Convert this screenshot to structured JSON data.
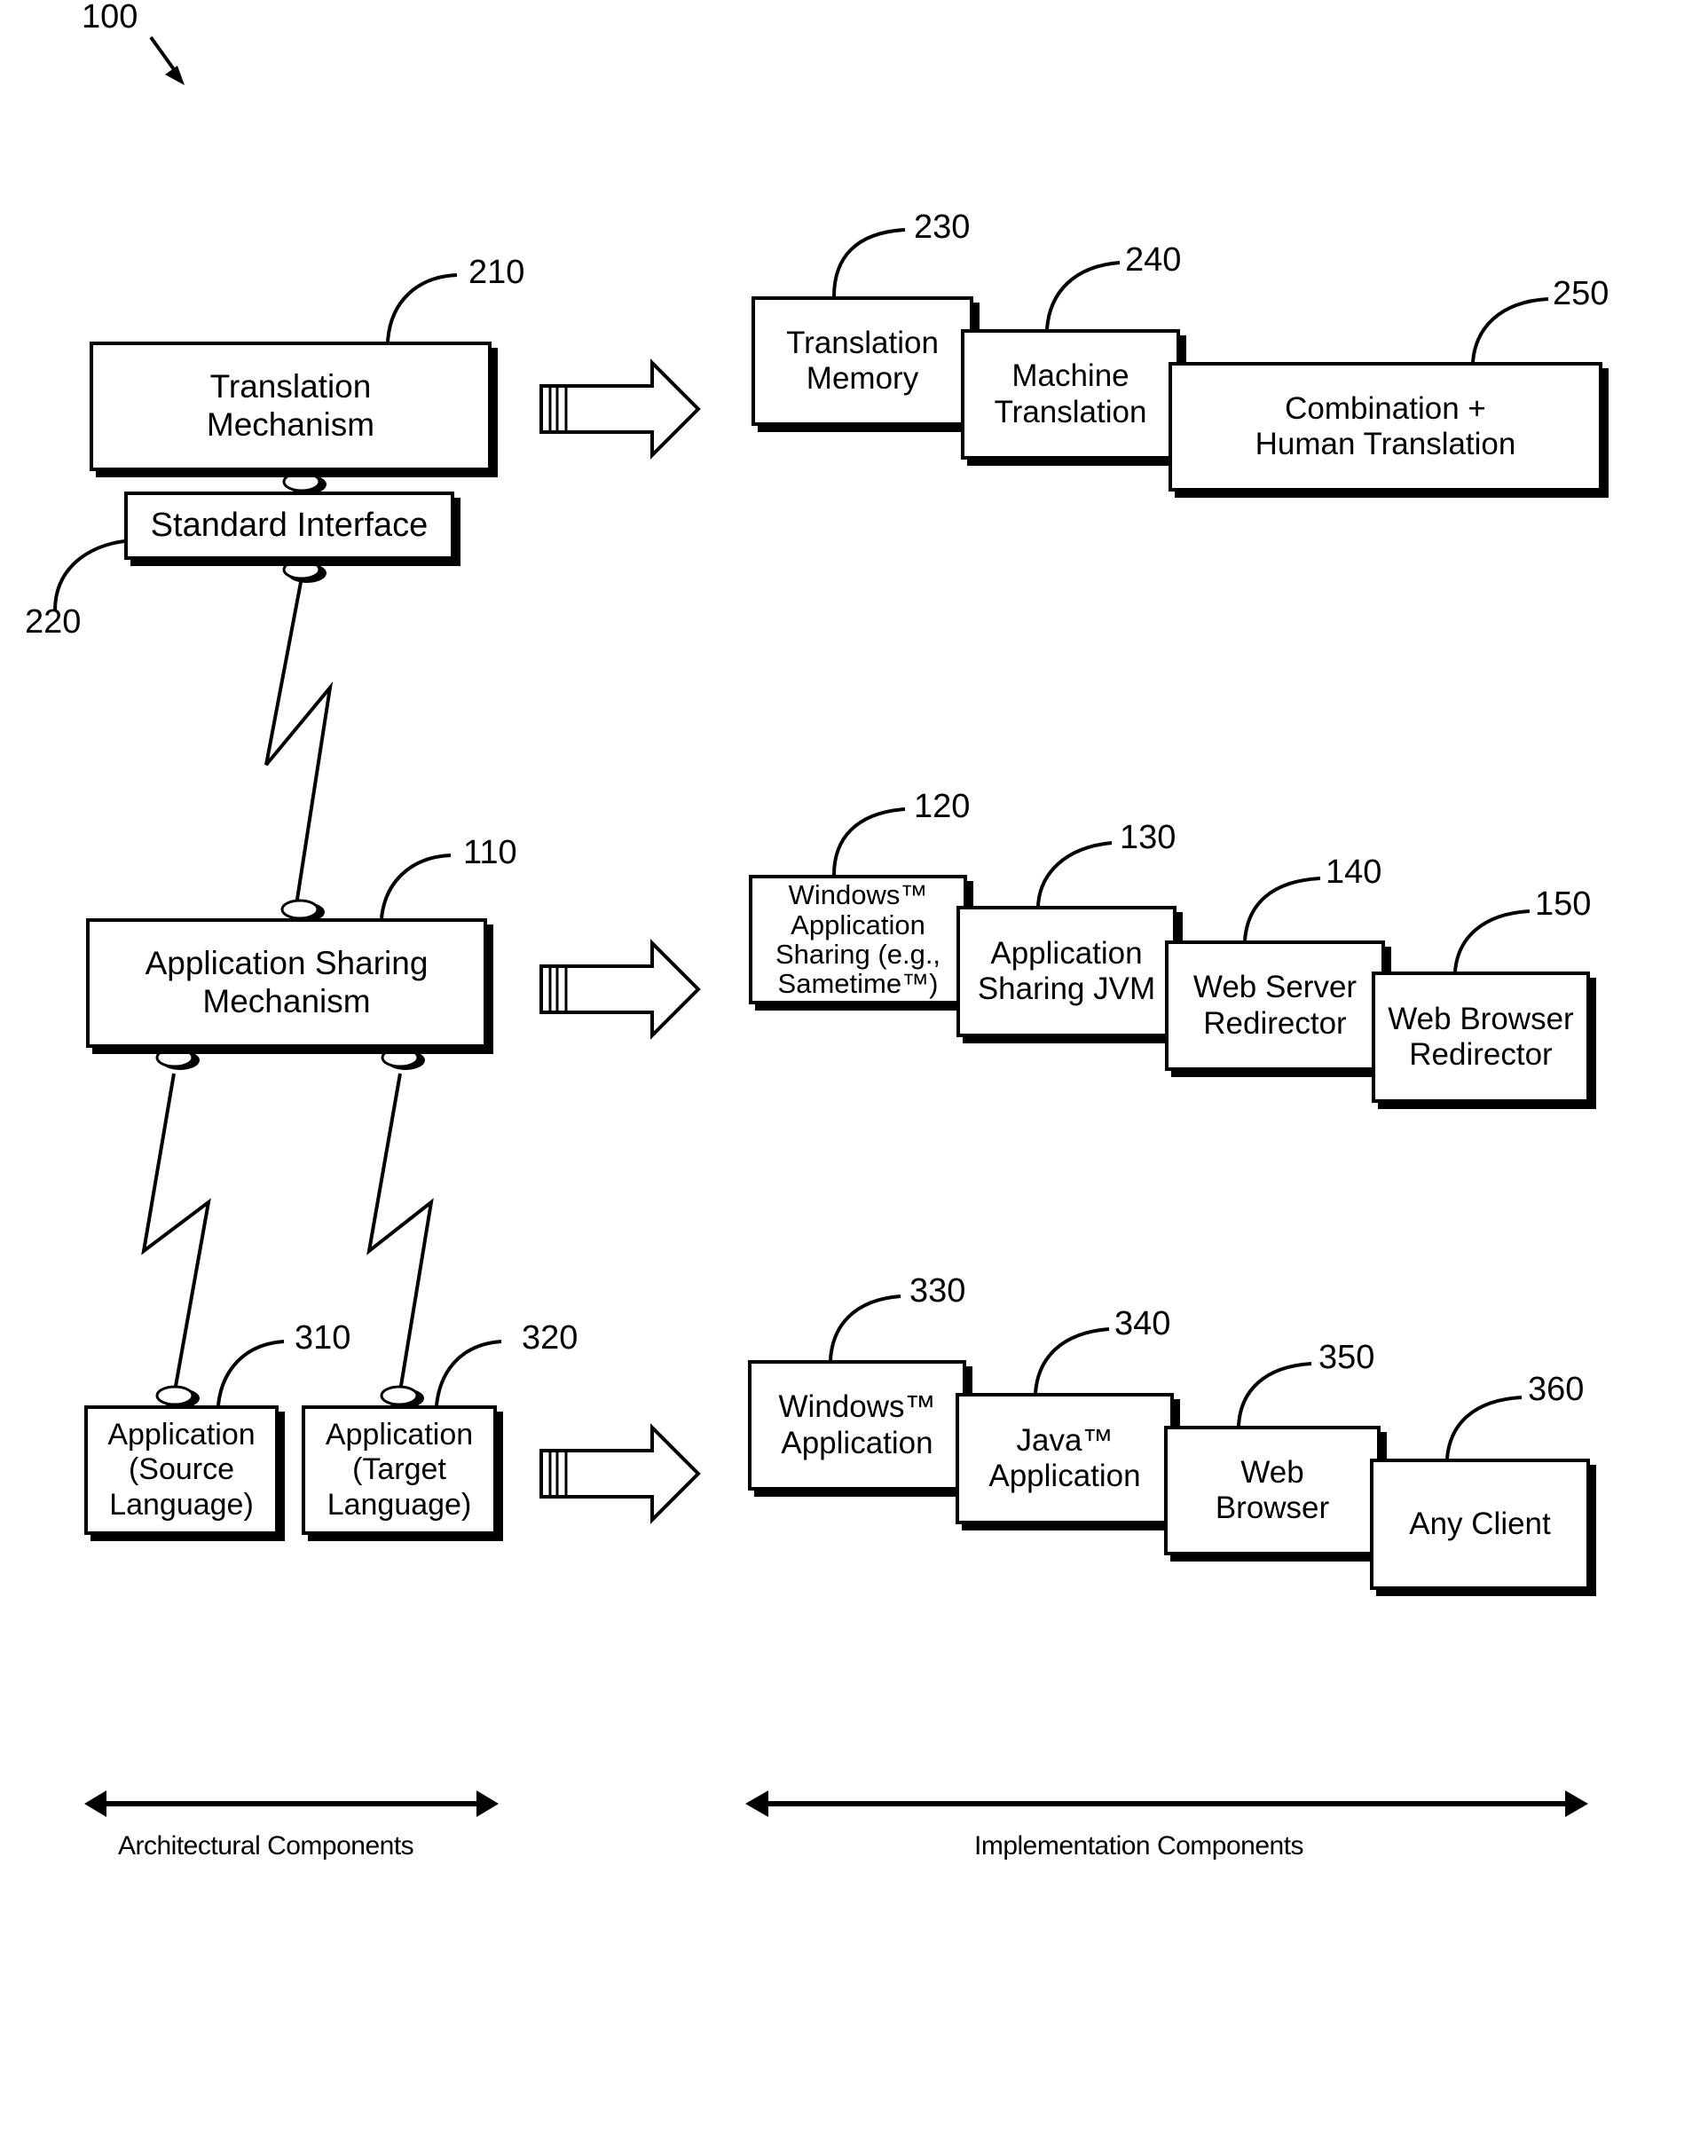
{
  "figure_label": "100",
  "architectural": {
    "translation_mechanism": {
      "label": "Translation\nMechanism",
      "ref": "210"
    },
    "standard_interface": {
      "label": "Standard Interface",
      "ref": "220"
    },
    "application_sharing_mechanism": {
      "label": "Application Sharing\nMechanism",
      "ref": "110"
    },
    "application_source": {
      "label": "Application\n(Source\nLanguage)",
      "ref": "310"
    },
    "application_target": {
      "label": "Application\n(Target\nLanguage)",
      "ref": "320"
    }
  },
  "implementation": {
    "translation_row": [
      {
        "label": "Translation\nMemory",
        "ref": "230"
      },
      {
        "label": "Machine\nTranslation",
        "ref": "240"
      },
      {
        "label": "Combination +\nHuman Translation",
        "ref": "250"
      }
    ],
    "sharing_row": [
      {
        "label": "Windows™\nApplication\nSharing (e.g.,\nSametime™)",
        "ref": "120"
      },
      {
        "label": "Application\nSharing JVM",
        "ref": "130"
      },
      {
        "label": "Web Server\nRedirector",
        "ref": "140"
      },
      {
        "label": "Web Browser\nRedirector",
        "ref": "150"
      }
    ],
    "client_row": [
      {
        "label": "Windows™\nApplication",
        "ref": "330"
      },
      {
        "label": "Java™\nApplication",
        "ref": "340"
      },
      {
        "label": "Web\nBrowser",
        "ref": "350"
      },
      {
        "label": "Any Client",
        "ref": "360"
      }
    ]
  },
  "captions": {
    "architectural": "Architectural Components",
    "implementation": "Implementation Components"
  }
}
